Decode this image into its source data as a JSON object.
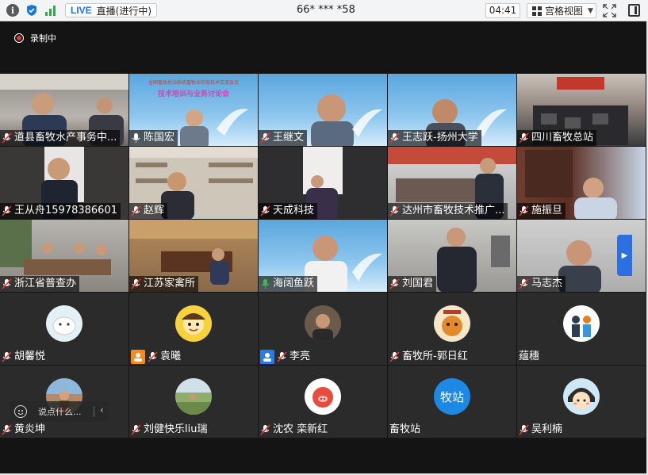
{
  "topbar": {
    "live_badge": "LIVE",
    "live_status": "直播(进行中)",
    "meeting_id": "66* *** *58",
    "time": "04:41",
    "view_label": "宫格视图"
  },
  "recording": {
    "label": "录制中"
  },
  "banner": {
    "title": "全国畜牧总站系统畜牧业防疫技术交流会议",
    "subtitle": "技术培训与业务讨论会"
  },
  "participants": [
    {
      "name": "道县畜牧水产事务中..."
    },
    {
      "name": "陈国宏"
    },
    {
      "name": "王继文"
    },
    {
      "name": "王志跃-扬州大学"
    },
    {
      "name": "四川畜牧总站"
    },
    {
      "name": "王从舟15978386601"
    },
    {
      "name": "赵辉"
    },
    {
      "name": "天成科技"
    },
    {
      "name": "达州市畜牧技术推广..."
    },
    {
      "name": "施振旦"
    },
    {
      "name": "浙江省普查办"
    },
    {
      "name": "江苏家禽所"
    },
    {
      "name": "海阔鱼跃"
    },
    {
      "name": "刘国君"
    },
    {
      "name": "马志杰"
    },
    {
      "name": "胡馨悦"
    },
    {
      "name": "袁曦"
    },
    {
      "name": "李亮"
    },
    {
      "name": "畜牧所-郭日红"
    },
    {
      "name": "蕴穗"
    },
    {
      "name": "黄炎坤"
    },
    {
      "name": "刘健快乐liu瑞"
    },
    {
      "name": "沈农 栾新红"
    },
    {
      "name": "畜牧站",
      "avatar_text": "牧站"
    },
    {
      "name": "吴利楠"
    }
  ],
  "chat": {
    "placeholder": "说点什么..."
  },
  "colors": {
    "live": "#1a73e8",
    "accent_blue": "#2b6fe0",
    "badge_orange": "#f58a1f",
    "mic_green": "#3bbf4a"
  }
}
